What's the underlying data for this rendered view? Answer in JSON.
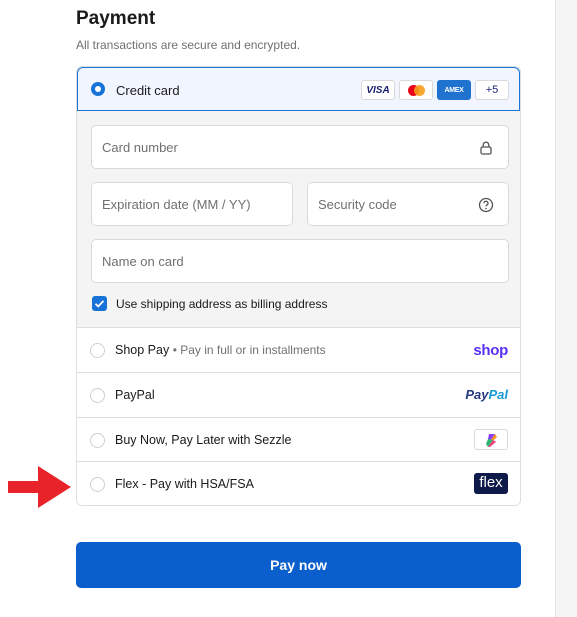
{
  "payment": {
    "title": "Payment",
    "subtitle": "All transactions are secure and encrypted."
  },
  "credit_card": {
    "label": "Credit card",
    "selected": true,
    "brands": [
      "VISA",
      "mastercard",
      "AMEX",
      "+5"
    ],
    "fields": {
      "card_number_placeholder": "Card number",
      "expiration_placeholder": "Expiration date (MM / YY)",
      "security_code_placeholder": "Security code",
      "name_placeholder": "Name on card"
    },
    "billing_checkbox": {
      "label": "Use shipping address as billing address",
      "checked": true
    }
  },
  "options": {
    "shop_pay": {
      "label": "Shop Pay",
      "sub": "• Pay in full or in installments",
      "logo": "shop"
    },
    "paypal": {
      "label": "PayPal",
      "logo_a": "Pay",
      "logo_b": "Pal"
    },
    "sezzle": {
      "label": "Buy Now, Pay Later with Sezzle"
    },
    "flex": {
      "label": "Flex - Pay with HSA/FSA",
      "logo": "flex"
    }
  },
  "pay_button": {
    "label": "Pay now"
  },
  "colors": {
    "accent": "#0b5fcc",
    "selected_bg": "#f0f5ff",
    "arrow": "#e8232a",
    "shop_purple": "#5a31f4",
    "flex_navy": "#0e1a4a"
  },
  "icons": {
    "card_number": "lock-icon",
    "security_code": "question-circle-icon",
    "annotation": "red-arrow-icon"
  }
}
